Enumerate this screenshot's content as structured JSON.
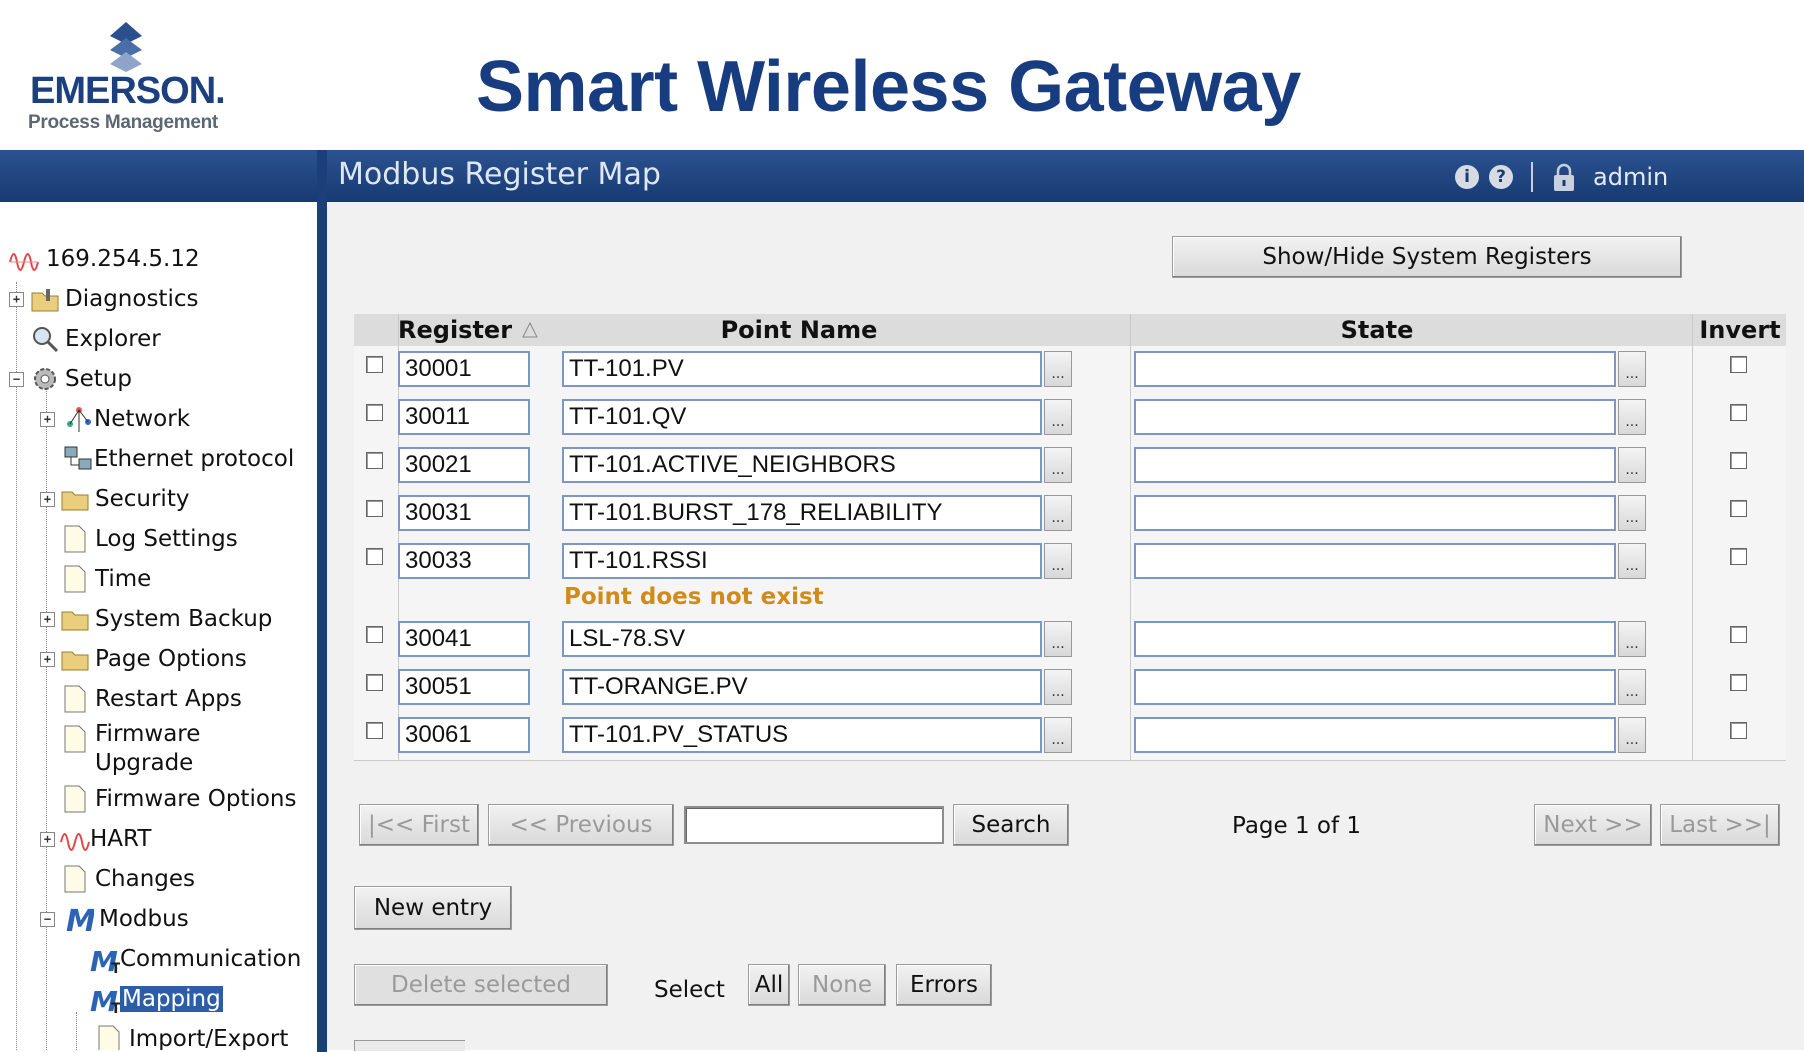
{
  "brand": {
    "name": "EMERSON.",
    "subtitle": "Process Management",
    "app_title": "Smart Wireless Gateway"
  },
  "topbar": {
    "page_heading": "Modbus Register Map",
    "info_icon": "info-icon",
    "help_icon": "help-icon",
    "lock_icon": "lock-icon",
    "user": "admin"
  },
  "tree": {
    "root": "169.254.5.12",
    "items": [
      {
        "label": "Diagnostics",
        "icon": "diagnostics-folder-icon"
      },
      {
        "label": "Explorer",
        "icon": "explorer-icon"
      },
      {
        "label": "Setup",
        "icon": "setup-gear-icon"
      },
      {
        "label": "Network",
        "icon": "network-icon"
      },
      {
        "label": "Ethernet protocol",
        "icon": "ethernet-icon"
      },
      {
        "label": "Security",
        "icon": "folder-icon"
      },
      {
        "label": "Log Settings",
        "icon": "page-icon"
      },
      {
        "label": "Time",
        "icon": "page-icon"
      },
      {
        "label": "System Backup",
        "icon": "folder-icon"
      },
      {
        "label": "Page Options",
        "icon": "folder-icon"
      },
      {
        "label": "Restart Apps",
        "icon": "page-icon"
      },
      {
        "label": "Firmware",
        "label2": "Upgrade",
        "icon": "page-icon"
      },
      {
        "label": "Firmware Options",
        "icon": "page-icon"
      },
      {
        "label": "HART",
        "icon": "hart-icon"
      },
      {
        "label": "Changes",
        "icon": "page-icon"
      },
      {
        "label": "Modbus",
        "icon": "modbus-icon"
      },
      {
        "label": "Communication",
        "icon": "modbus-t-icon"
      },
      {
        "label": "Mapping",
        "icon": "modbus-t-icon",
        "selected": true
      },
      {
        "label": "Import/Export",
        "icon": "page-icon"
      }
    ]
  },
  "toolbar": {
    "show_hide_label": "Show/Hide System Registers"
  },
  "table": {
    "headers": {
      "register": "Register",
      "point_name": "Point Name",
      "state": "State",
      "invert": "Invert"
    },
    "rows": [
      {
        "register": "30001",
        "point_name": "TT-101.PV",
        "state": "",
        "invert": false,
        "checked": false
      },
      {
        "register": "30011",
        "point_name": "TT-101.QV",
        "state": "",
        "invert": false,
        "checked": false
      },
      {
        "register": "30021",
        "point_name": "TT-101.ACTIVE_NEIGHBORS",
        "state": "",
        "invert": false,
        "checked": false
      },
      {
        "register": "30031",
        "point_name": "TT-101.BURST_178_RELIABILITY",
        "state": "",
        "invert": false,
        "checked": false
      },
      {
        "register": "30033",
        "point_name": "TT-101.RSSI",
        "state": "",
        "invert": false,
        "checked": false,
        "error": "Point does not exist"
      },
      {
        "register": "30041",
        "point_name": "LSL-78.SV",
        "state": "",
        "invert": false,
        "checked": false
      },
      {
        "register": "30051",
        "point_name": "TT-ORANGE.PV",
        "state": "",
        "invert": false,
        "checked": false
      },
      {
        "register": "30061",
        "point_name": "TT-101.PV_STATUS",
        "state": "",
        "invert": false,
        "checked": false
      }
    ],
    "browse_label": "..."
  },
  "pager": {
    "first": "|<< First",
    "previous": "<< Previous",
    "search_value": "",
    "search": "Search",
    "page_info": "Page 1 of 1",
    "next": "Next >>",
    "last": "Last >>|"
  },
  "actions": {
    "new_entry": "New entry",
    "delete_selected": "Delete selected",
    "select_label": "Select",
    "all": "All",
    "none": "None",
    "errors": "Errors"
  },
  "colors": {
    "brand_blue": "#173d80",
    "bar_blue": "#1f4680",
    "error_orange": "#d08b1a",
    "selection": "#2c5ea8"
  }
}
